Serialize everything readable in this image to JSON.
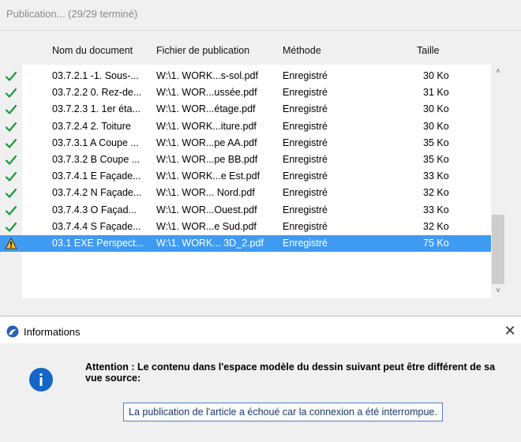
{
  "publication": {
    "title": "Publication... (29/29 terminé)",
    "columns": {
      "name": "Nom du document",
      "file": "Fichier de publication",
      "method": "Méthode",
      "size": "Taille"
    },
    "rows": [
      {
        "status": "check-icon",
        "name": "03.7.2.1 -1. Sous-...",
        "file": "W:\\1. WORK...s-sol.pdf",
        "method": "Enregistré",
        "size": "30 Ko"
      },
      {
        "status": "check-icon",
        "name": "03.7.2.2 0. Rez-de...",
        "file": "W:\\1. WOR...ussée.pdf",
        "method": "Enregistré",
        "size": "31 Ko"
      },
      {
        "status": "check-icon",
        "name": "03.7.2.3 1. 1er éta...",
        "file": "W:\\1. WOR...étage.pdf",
        "method": "Enregistré",
        "size": "30 Ko"
      },
      {
        "status": "check-icon",
        "name": "03.7.2.4 2. Toiture",
        "file": "W:\\1. WORK...iture.pdf",
        "method": "Enregistré",
        "size": "30 Ko"
      },
      {
        "status": "check-icon",
        "name": "03.7.3.1 A Coupe ...",
        "file": "W:\\1. WOR...pe AA.pdf",
        "method": "Enregistré",
        "size": "35 Ko"
      },
      {
        "status": "check-icon",
        "name": "03.7.3.2 B Coupe ...",
        "file": "W:\\1. WOR...pe BB.pdf",
        "method": "Enregistré",
        "size": "35 Ko"
      },
      {
        "status": "check-icon",
        "name": "03.7.4.1 E Façade...",
        "file": "W:\\1. WORK...e Est.pdf",
        "method": "Enregistré",
        "size": "33 Ko"
      },
      {
        "status": "check-icon",
        "name": "03.7.4.2 N Façade...",
        "file": "W:\\1. WOR... Nord.pdf",
        "method": "Enregistré",
        "size": "32 Ko"
      },
      {
        "status": "check-icon",
        "name": "03.7.4.3 O Façad...",
        "file": "W:\\1. WOR...Ouest.pdf",
        "method": "Enregistré",
        "size": "33 Ko"
      },
      {
        "status": "check-icon",
        "name": "03.7.4.4 S Façade...",
        "file": "W:\\1. WOR...e Sud.pdf",
        "method": "Enregistré",
        "size": "32 Ko"
      },
      {
        "status": "warning-icon",
        "name": "03.1 EXE Perspect...",
        "file": "W:\\1. WORK... 3D_2.pdf",
        "method": "Enregistré",
        "size": "75 Ko",
        "selected": true
      }
    ]
  },
  "dialog": {
    "title": "Informations",
    "message": "Attention : Le contenu dans l'espace modèle du dessin suivant peut être différent de sa vue source:",
    "detail": "La publication de l'article a échoué car la connexion a été interrompue."
  },
  "colors": {
    "selection": "#3f9bf2",
    "check": "#1a9a3a",
    "warning": "#f2c318",
    "info_icon": "#1565c8"
  }
}
